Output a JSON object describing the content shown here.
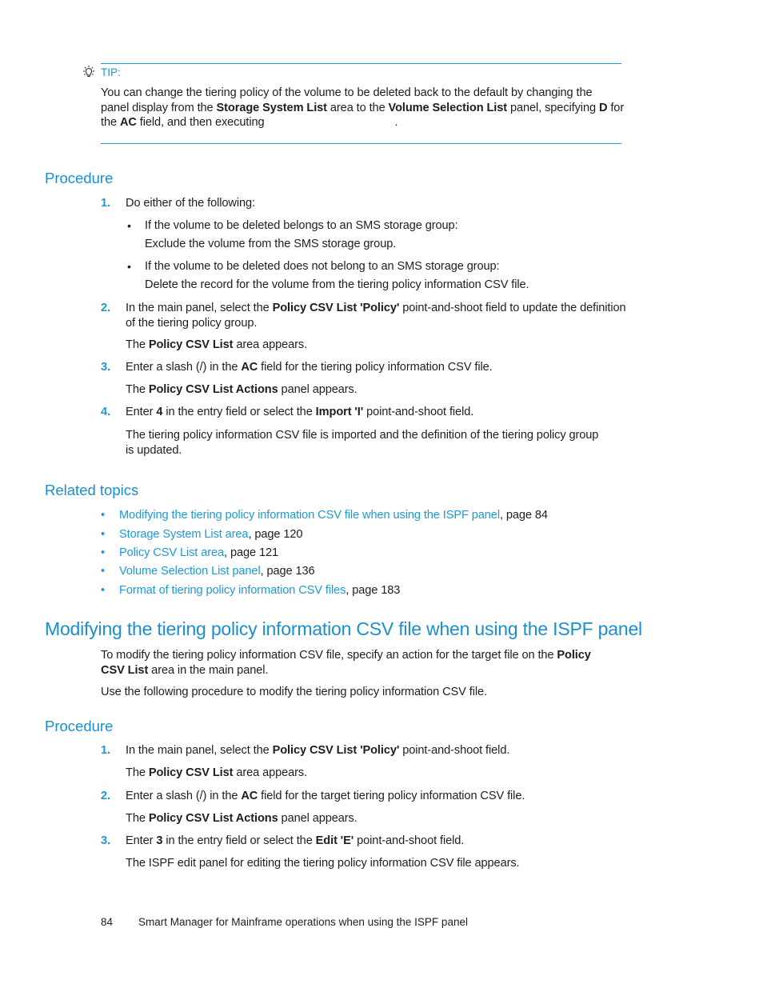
{
  "tip": {
    "label": "TIP:",
    "icon": "lightbulb-icon",
    "line1": "You can change the tiering policy of the volume to be deleted back to the default by changing the",
    "line2_pre": "panel display from the ",
    "line2_b1": "Storage System List",
    "line2_mid": " area to the ",
    "line2_b2": "Volume Selection List",
    "line2_post": " panel, specifying ",
    "line2_b3": "D",
    "line2_end": " for",
    "line3_pre": "the ",
    "line3_b1": "AC",
    "line3_post": " field, and then executing",
    "line3_end": "."
  },
  "section1": {
    "heading": "Procedure",
    "steps": [
      {
        "num": "1.",
        "text": "Do either of the following:",
        "bullets": [
          {
            "line1": "If the volume to be deleted belongs to an SMS storage group:",
            "line2": "Exclude the volume from the SMS storage group."
          },
          {
            "line1": "If the volume to be deleted does not belong to an SMS storage group:",
            "line2": "Delete the record for the volume from the tiering policy information CSV file."
          }
        ]
      },
      {
        "num": "2.",
        "pre": "In the main panel, select the ",
        "bold": "Policy CSV List 'Policy'",
        "post": " point-and-shoot field to update the definition",
        "line2": "of the tiering policy group.",
        "result_pre": "The ",
        "result_bold": "Policy CSV List",
        "result_post": " area appears."
      },
      {
        "num": "3.",
        "pre": "Enter a slash (/) in the ",
        "bold": "AC",
        "post": " field for the tiering policy information CSV file.",
        "result_pre": "The ",
        "result_bold": "Policy CSV List Actions",
        "result_post": " panel appears."
      },
      {
        "num": "4.",
        "pre": "Enter ",
        "bold": "4",
        "mid": " in the entry field or select the ",
        "bold2": "Import 'I'",
        "post": " point-and-shoot field.",
        "result_line1": "The tiering policy information CSV file is imported and the definition of the tiering policy group",
        "result_line2": "is updated."
      }
    ]
  },
  "related": {
    "heading": "Related topics",
    "items": [
      {
        "link": "Modifying the tiering policy information CSV file when using the ISPF panel",
        "page": ", page 84"
      },
      {
        "link": "Storage System List area",
        "page": ", page 120"
      },
      {
        "link": "Policy CSV List area",
        "page": ", page 121"
      },
      {
        "link": "Volume Selection List panel",
        "page": ", page 136"
      },
      {
        "link": "Format of tiering policy information CSV files",
        "page": ", page 183"
      }
    ]
  },
  "section2": {
    "title": "Modifying the tiering policy information CSV file when using the ISPF panel",
    "intro_pre": "To modify the tiering policy information CSV file, specify an action for the target file on the ",
    "intro_bold1": "Policy",
    "intro_bold2": "CSV List",
    "intro_post": " area in the main panel.",
    "intro2": "Use the following procedure to modify the tiering policy information CSV file.",
    "procedure_heading": "Procedure",
    "steps": [
      {
        "num": "1.",
        "pre": "In the main panel, select the ",
        "bold": "Policy CSV List 'Policy'",
        "post": " point-and-shoot field.",
        "result_pre": "The ",
        "result_bold": "Policy CSV List",
        "result_post": " area appears."
      },
      {
        "num": "2.",
        "pre": "Enter a slash (/) in the ",
        "bold": "AC",
        "post": " field for the target tiering policy information CSV file.",
        "result_pre": "The ",
        "result_bold": "Policy CSV List Actions",
        "result_post": " panel appears."
      },
      {
        "num": "3.",
        "pre": "Enter ",
        "bold": "3",
        "mid": " in the entry field or select the ",
        "bold2": "Edit 'E'",
        "post": " point-and-shoot field.",
        "result": "The ISPF edit panel for editing the tiering policy information CSV file appears."
      }
    ]
  },
  "footer": {
    "page_number": "84",
    "title": "Smart Manager for Mainframe operations when using the ISPF panel"
  }
}
